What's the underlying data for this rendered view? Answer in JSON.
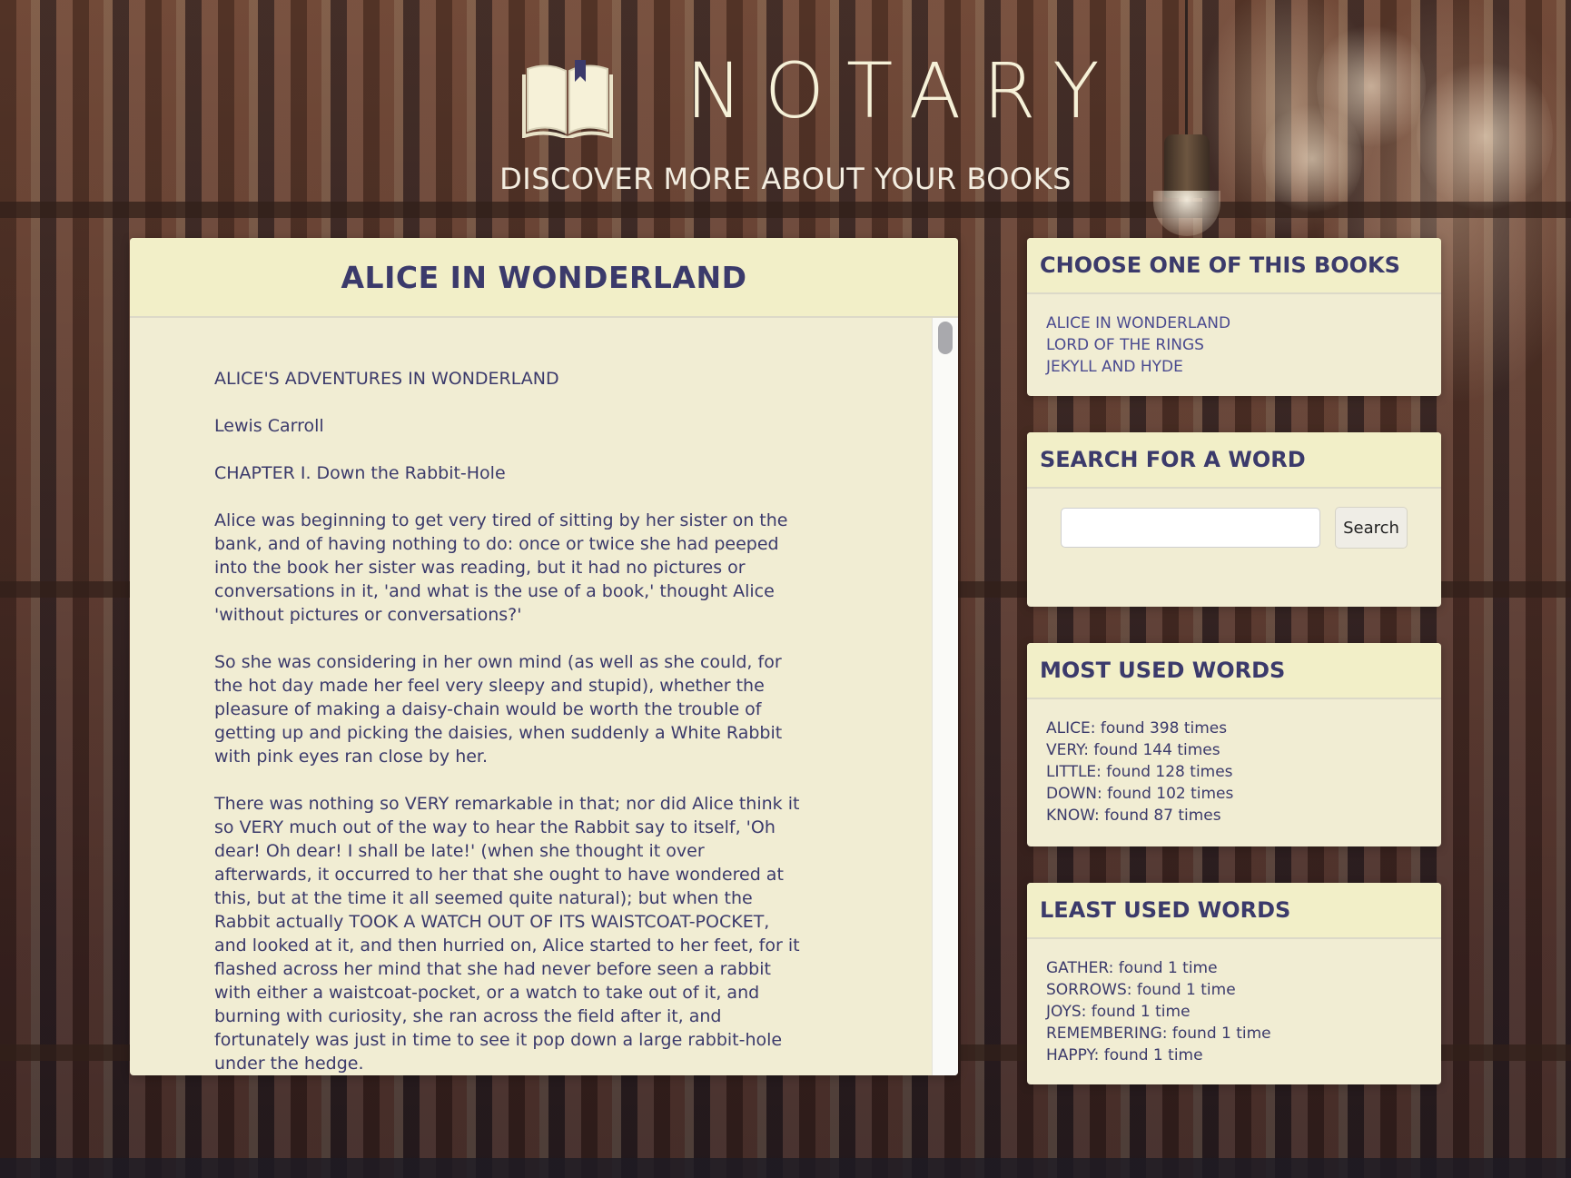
{
  "brand": {
    "name": "NOTARY",
    "tagline": "DISCOVER MORE ABOUT YOUR BOOKS",
    "icon": "open-book-icon"
  },
  "book": {
    "title": "ALICE IN WONDERLAND",
    "paragraphs": [
      "ALICE'S ADVENTURES IN WONDERLAND",
      "Lewis Carroll",
      "CHAPTER I. Down the Rabbit-Hole",
      "Alice was beginning to get very tired of sitting by her sister on the bank, and of having nothing to do: once or twice she had peeped into the book her sister was reading, but it had no pictures or conversations in it, 'and what is the use of a book,' thought Alice 'without pictures or conversations?'",
      "So she was considering in her own mind (as well as she could, for the hot day made her feel very sleepy and stupid), whether the pleasure of making a daisy-chain would be worth the trouble of getting up and picking the daisies, when suddenly a White Rabbit with pink eyes ran close by her.",
      "There was nothing so VERY remarkable in that; nor did Alice think it so VERY much out of the way to hear the Rabbit say to itself, 'Oh dear! Oh dear! I shall be late!' (when she thought it over afterwards, it occurred to her that she ought to have wondered at this, but at the time it all seemed quite natural); but when the Rabbit actually TOOK A WATCH OUT OF ITS WAISTCOAT-POCKET, and looked at it, and then hurried on, Alice started to her feet, for it flashed across her mind that she had never before seen a rabbit with either a waistcoat-pocket, or a watch to take out of it, and burning with curiosity, she ran across the field after it, and fortunately was just in time to see it pop down a large rabbit-hole under the hedge."
    ]
  },
  "choose_books": {
    "title": "CHOOSE ONE OF THIS BOOKS",
    "items": [
      "ALICE IN WONDERLAND",
      "LORD OF THE RINGS",
      "JEKYLL AND HYDE"
    ]
  },
  "search": {
    "title": "SEARCH FOR A WORD",
    "value": "",
    "placeholder": "",
    "button_label": "Search"
  },
  "most_used": {
    "title": "MOST USED WORDS",
    "items": [
      "ALICE: found 398 times",
      "VERY: found 144 times",
      "LITTLE: found 128 times",
      "DOWN: found 102 times",
      "KNOW: found 87 times"
    ]
  },
  "least_used": {
    "title": "LEAST USED WORDS",
    "items": [
      "GATHER: found 1 time",
      "SORROWS: found 1 time",
      "JOYS: found 1 time",
      "REMEMBERING: found 1 time",
      "HAPPY: found 1 time"
    ]
  },
  "colors": {
    "panel_bg": "#f1edd3",
    "panel_header_bg": "#f2efc8",
    "text": "#3b3a6b",
    "brand": "#f6f1d8"
  }
}
